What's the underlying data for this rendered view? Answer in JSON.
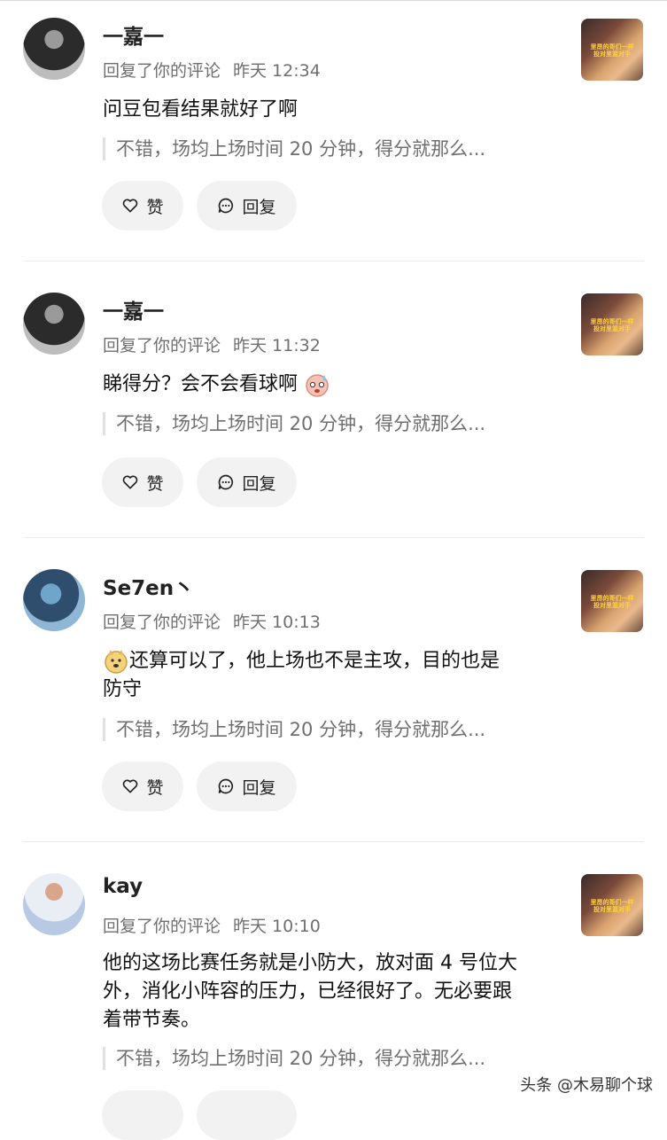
{
  "comments": [
    {
      "username": "一嘉一",
      "action": "回复了你的评论",
      "time": "昨天 12:34",
      "text": "问豆包看结果就好了啊",
      "quote": "不错，场均上场时间 20 分钟，得分就那么...",
      "like_label": "赞",
      "reply_label": "回复",
      "thumb_caption": "里昂的哥们一样 投对里篮对手"
    },
    {
      "username": "一嘉一",
      "action": "回复了你的评论",
      "time": "昨天 11:32",
      "text": "睇得分？会不会看球啊",
      "quote": "不错，场均上场时间 20 分钟，得分就那么...",
      "like_label": "赞",
      "reply_label": "回复",
      "thumb_caption": "里昂的哥们一样 投对里篮对手"
    },
    {
      "username": "Se7en丶",
      "action": "回复了你的评论",
      "time": "昨天 10:13",
      "text_line1": "还算可以了，他上场也不是主攻，目的也是",
      "text_line2": "防守",
      "quote": "不错，场均上场时间 20 分钟，得分就那么...",
      "like_label": "赞",
      "reply_label": "回复",
      "thumb_caption": "里昂的哥们一样 投对里篮对手"
    },
    {
      "username": "kay",
      "action": "回复了你的评论",
      "time": "昨天 10:10",
      "text_line1": "他的这场比赛任务就是小防大，放对面 4 号位大",
      "text_line2": "外，消化小阵容的压力，已经很好了。无必要跟",
      "text_line3": "着带节奏。",
      "quote": "不错，场均上场时间 20 分钟，得分就那么...",
      "thumb_caption": "里昂的哥们一样 投对里篮对手"
    }
  ],
  "watermark": "头条 @木易聊个球",
  "icons": {
    "like": "heart-icon",
    "reply": "chat-bubble-icon"
  },
  "colors": {
    "button_bg": "#f2f2f2",
    "meta_text": "#6f6f6f"
  }
}
